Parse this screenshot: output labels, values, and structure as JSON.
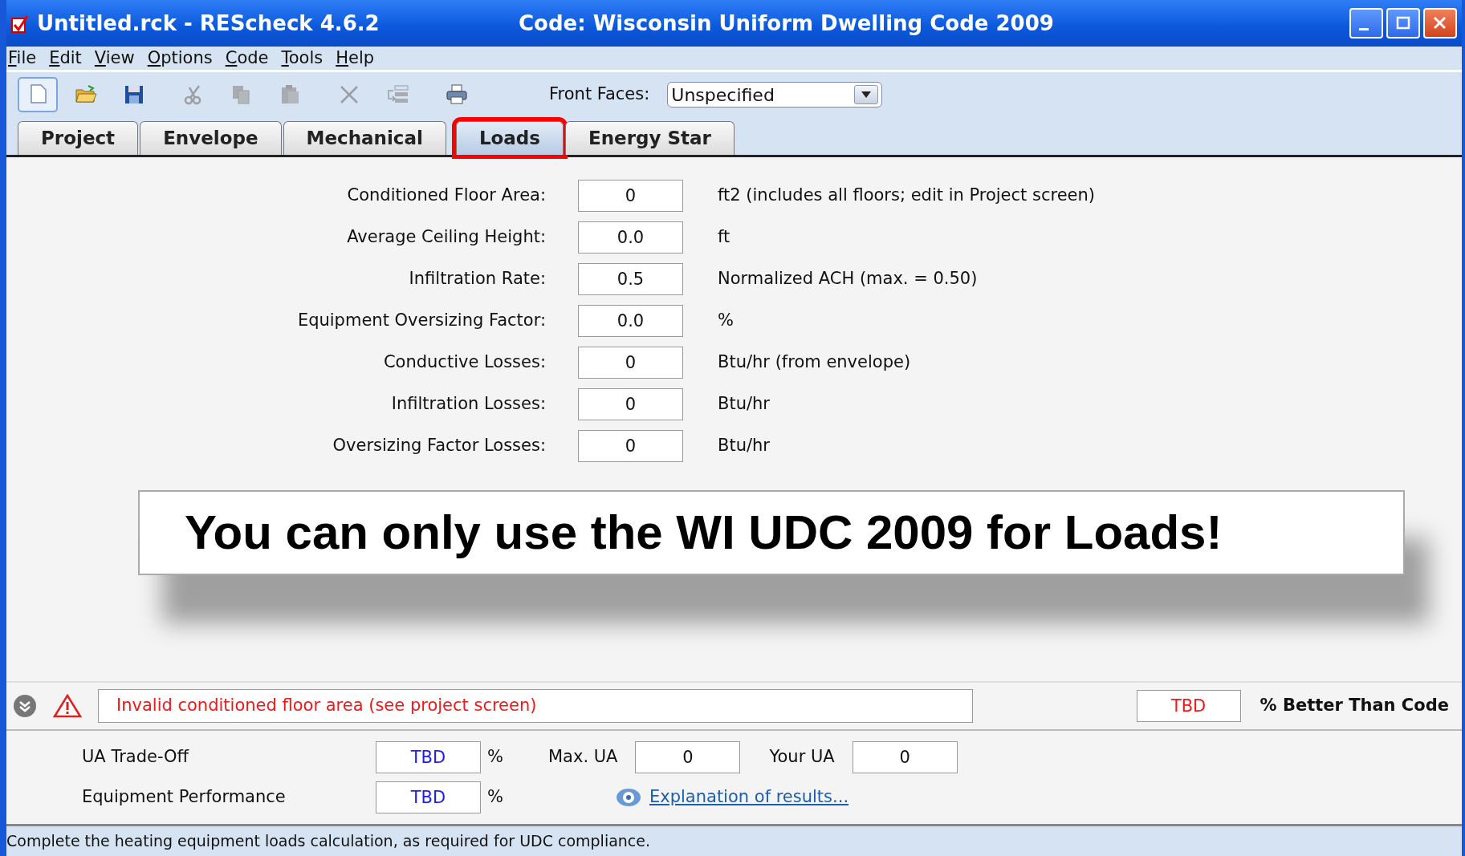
{
  "window": {
    "title": "Untitled.rck - REScheck 4.6.2",
    "code": "Code: Wisconsin Uniform Dwelling Code 2009"
  },
  "menu": [
    "File",
    "Edit",
    "View",
    "Options",
    "Code",
    "Tools",
    "Help"
  ],
  "toolbar": [
    {
      "kind": "new",
      "selected": true,
      "disabled": false
    },
    {
      "kind": "open",
      "selected": false,
      "disabled": false
    },
    {
      "kind": "save",
      "selected": false,
      "disabled": false
    },
    {
      "kind": "cut",
      "selected": false,
      "disabled": true
    },
    {
      "kind": "copy",
      "selected": false,
      "disabled": true
    },
    {
      "kind": "paste",
      "selected": false,
      "disabled": true
    },
    {
      "kind": "delete",
      "selected": false,
      "disabled": true
    },
    {
      "kind": "move",
      "selected": false,
      "disabled": true
    },
    {
      "kind": "print",
      "selected": false,
      "disabled": false
    }
  ],
  "front_faces": {
    "label": "Front Faces:",
    "value": "Unspecified"
  },
  "tabs": [
    {
      "label": "Project",
      "selected": false,
      "highlighted": false
    },
    {
      "label": "Envelope",
      "selected": false,
      "highlighted": false
    },
    {
      "label": "Mechanical",
      "selected": false,
      "highlighted": false
    },
    {
      "label": "Loads",
      "selected": true,
      "highlighted": true
    },
    {
      "label": "Energy Star",
      "selected": false,
      "highlighted": false
    }
  ],
  "fields": [
    {
      "label": "Conditioned Floor Area:",
      "value": "0",
      "unit": "ft2 (includes all floors; edit in Project screen)"
    },
    {
      "label": "Average Ceiling Height:",
      "value": "0.0",
      "unit": "ft"
    },
    {
      "label": "Infiltration Rate:",
      "value": "0.5",
      "unit": "Normalized ACH (max. = 0.50)"
    },
    {
      "label": "Equipment Oversizing Factor:",
      "value": "0.0",
      "unit": "%"
    },
    {
      "label": "Conductive Losses:",
      "value": "0",
      "unit": "Btu/hr (from envelope)"
    },
    {
      "label": "Infiltration Losses:",
      "value": "0",
      "unit": "Btu/hr"
    },
    {
      "label": "Oversizing Factor Losses:",
      "value": "0",
      "unit": "Btu/hr"
    }
  ],
  "callout": {
    "text": "You can only use the WI UDC 2009 for Loads!"
  },
  "message": {
    "text": "Invalid conditioned floor area (see project screen)",
    "result": "TBD",
    "result_label": "% Better Than Code"
  },
  "results": {
    "ua_label": "UA Trade-Off",
    "ua_value": "TBD",
    "ua_unit": "%",
    "max_label": "Max. UA",
    "max_value": "0",
    "your_label": "Your UA",
    "your_value": "0",
    "equip_label": "Equipment Performance",
    "equip_value": "TBD",
    "equip_unit": "%",
    "link": "Explanation of results..."
  },
  "status_bar": "Complete the heating equipment loads calculation, as required for UDC compliance."
}
